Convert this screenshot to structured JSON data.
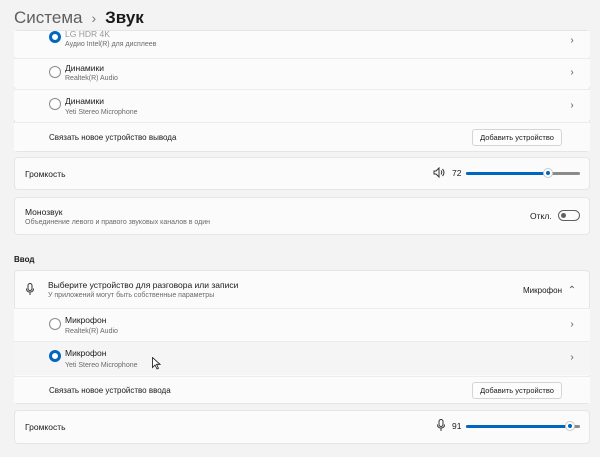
{
  "breadcrumb": {
    "root": "Система",
    "separator": "›",
    "current": "Звук"
  },
  "output": {
    "devices": [
      {
        "name": "LG HDR 4K",
        "sub": "Аудио Intel(R) для дисплеев",
        "selected": true
      },
      {
        "name": "Динамики",
        "sub": "Realtek(R) Audio",
        "selected": false
      },
      {
        "name": "Динамики",
        "sub": "Yeti Stereo Microphone",
        "selected": false
      }
    ],
    "pair_label": "Связать новое устройство вывода",
    "add_button": "Добавить устройство"
  },
  "output_volume": {
    "label": "Громкость",
    "value": "72",
    "level": 0.72
  },
  "mono": {
    "title": "Монозвук",
    "sub": "Объединение левого и правого звуковых каналов в один",
    "state": "Откл."
  },
  "input": {
    "section": "Ввод",
    "choose_title": "Выберите устройство для разговора или записи",
    "choose_sub": "У приложений могут быть собственные параметры",
    "current": "Микрофон",
    "devices": [
      {
        "name": "Микрофон",
        "sub": "Realtek(R) Audio",
        "selected": false
      },
      {
        "name": "Микрофон",
        "sub": "Yeti Stereo Microphone",
        "selected": true
      }
    ],
    "pair_label": "Связать новое устройство ввода",
    "add_button": "Добавить устройство"
  },
  "input_volume": {
    "label": "Громкость",
    "value": "91",
    "level": 0.91
  },
  "colors": {
    "accent": "#0067c0",
    "background": "#f3f3f3",
    "card": "#fbfbfb"
  }
}
